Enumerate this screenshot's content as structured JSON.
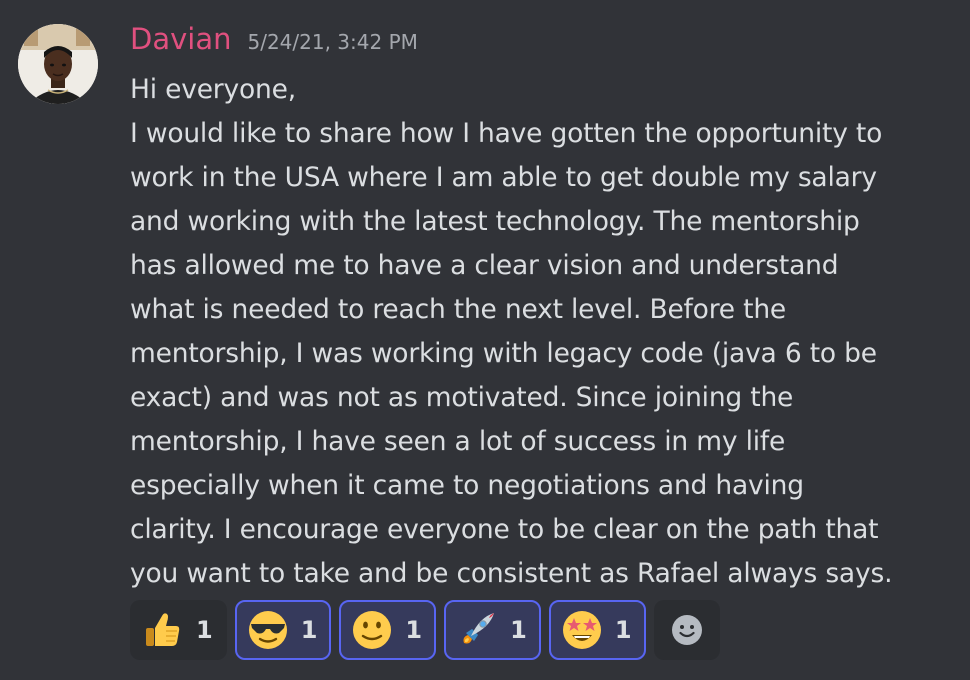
{
  "message": {
    "author": "Davian",
    "timestamp": "5/24/21, 3:42 PM",
    "lines": [
      "Hi everyone,",
      "I would like to share how I have gotten the opportunity to",
      "work in the USA where I am able to get double my salary",
      "and working with the latest technology. The mentorship",
      "has allowed me to have a clear vision and understand",
      "what is needed to reach the next level. Before the",
      "mentorship, I was working with legacy code (java 6 to be",
      "exact) and was not as motivated. Since joining the",
      "mentorship, I have seen a lot of success in my life",
      "especially when it came to negotiations and having",
      "clarity. I encourage everyone to be clear on the path that",
      "you want to take and be consistent as Rafael always says."
    ]
  },
  "reactions": [
    {
      "icon": "thumbs-up-icon",
      "count": "1",
      "selected": false
    },
    {
      "icon": "sunglasses-face-icon",
      "count": "1",
      "selected": true
    },
    {
      "icon": "slightly-smiling-face-icon",
      "count": "1",
      "selected": true
    },
    {
      "icon": "rocket-icon",
      "count": "1",
      "selected": true
    },
    {
      "icon": "star-struck-face-icon",
      "count": "1",
      "selected": true
    }
  ],
  "add_reaction": {
    "icon": "add-reaction-icon"
  },
  "colors": {
    "background": "#313338",
    "username": "#e0507f",
    "timestamp": "#a4a7ad",
    "text": "#dbdee1",
    "reaction_bg": "#2b2d31",
    "reaction_selected_bg": "#363a5c",
    "reaction_selected_border": "#5865f2"
  }
}
